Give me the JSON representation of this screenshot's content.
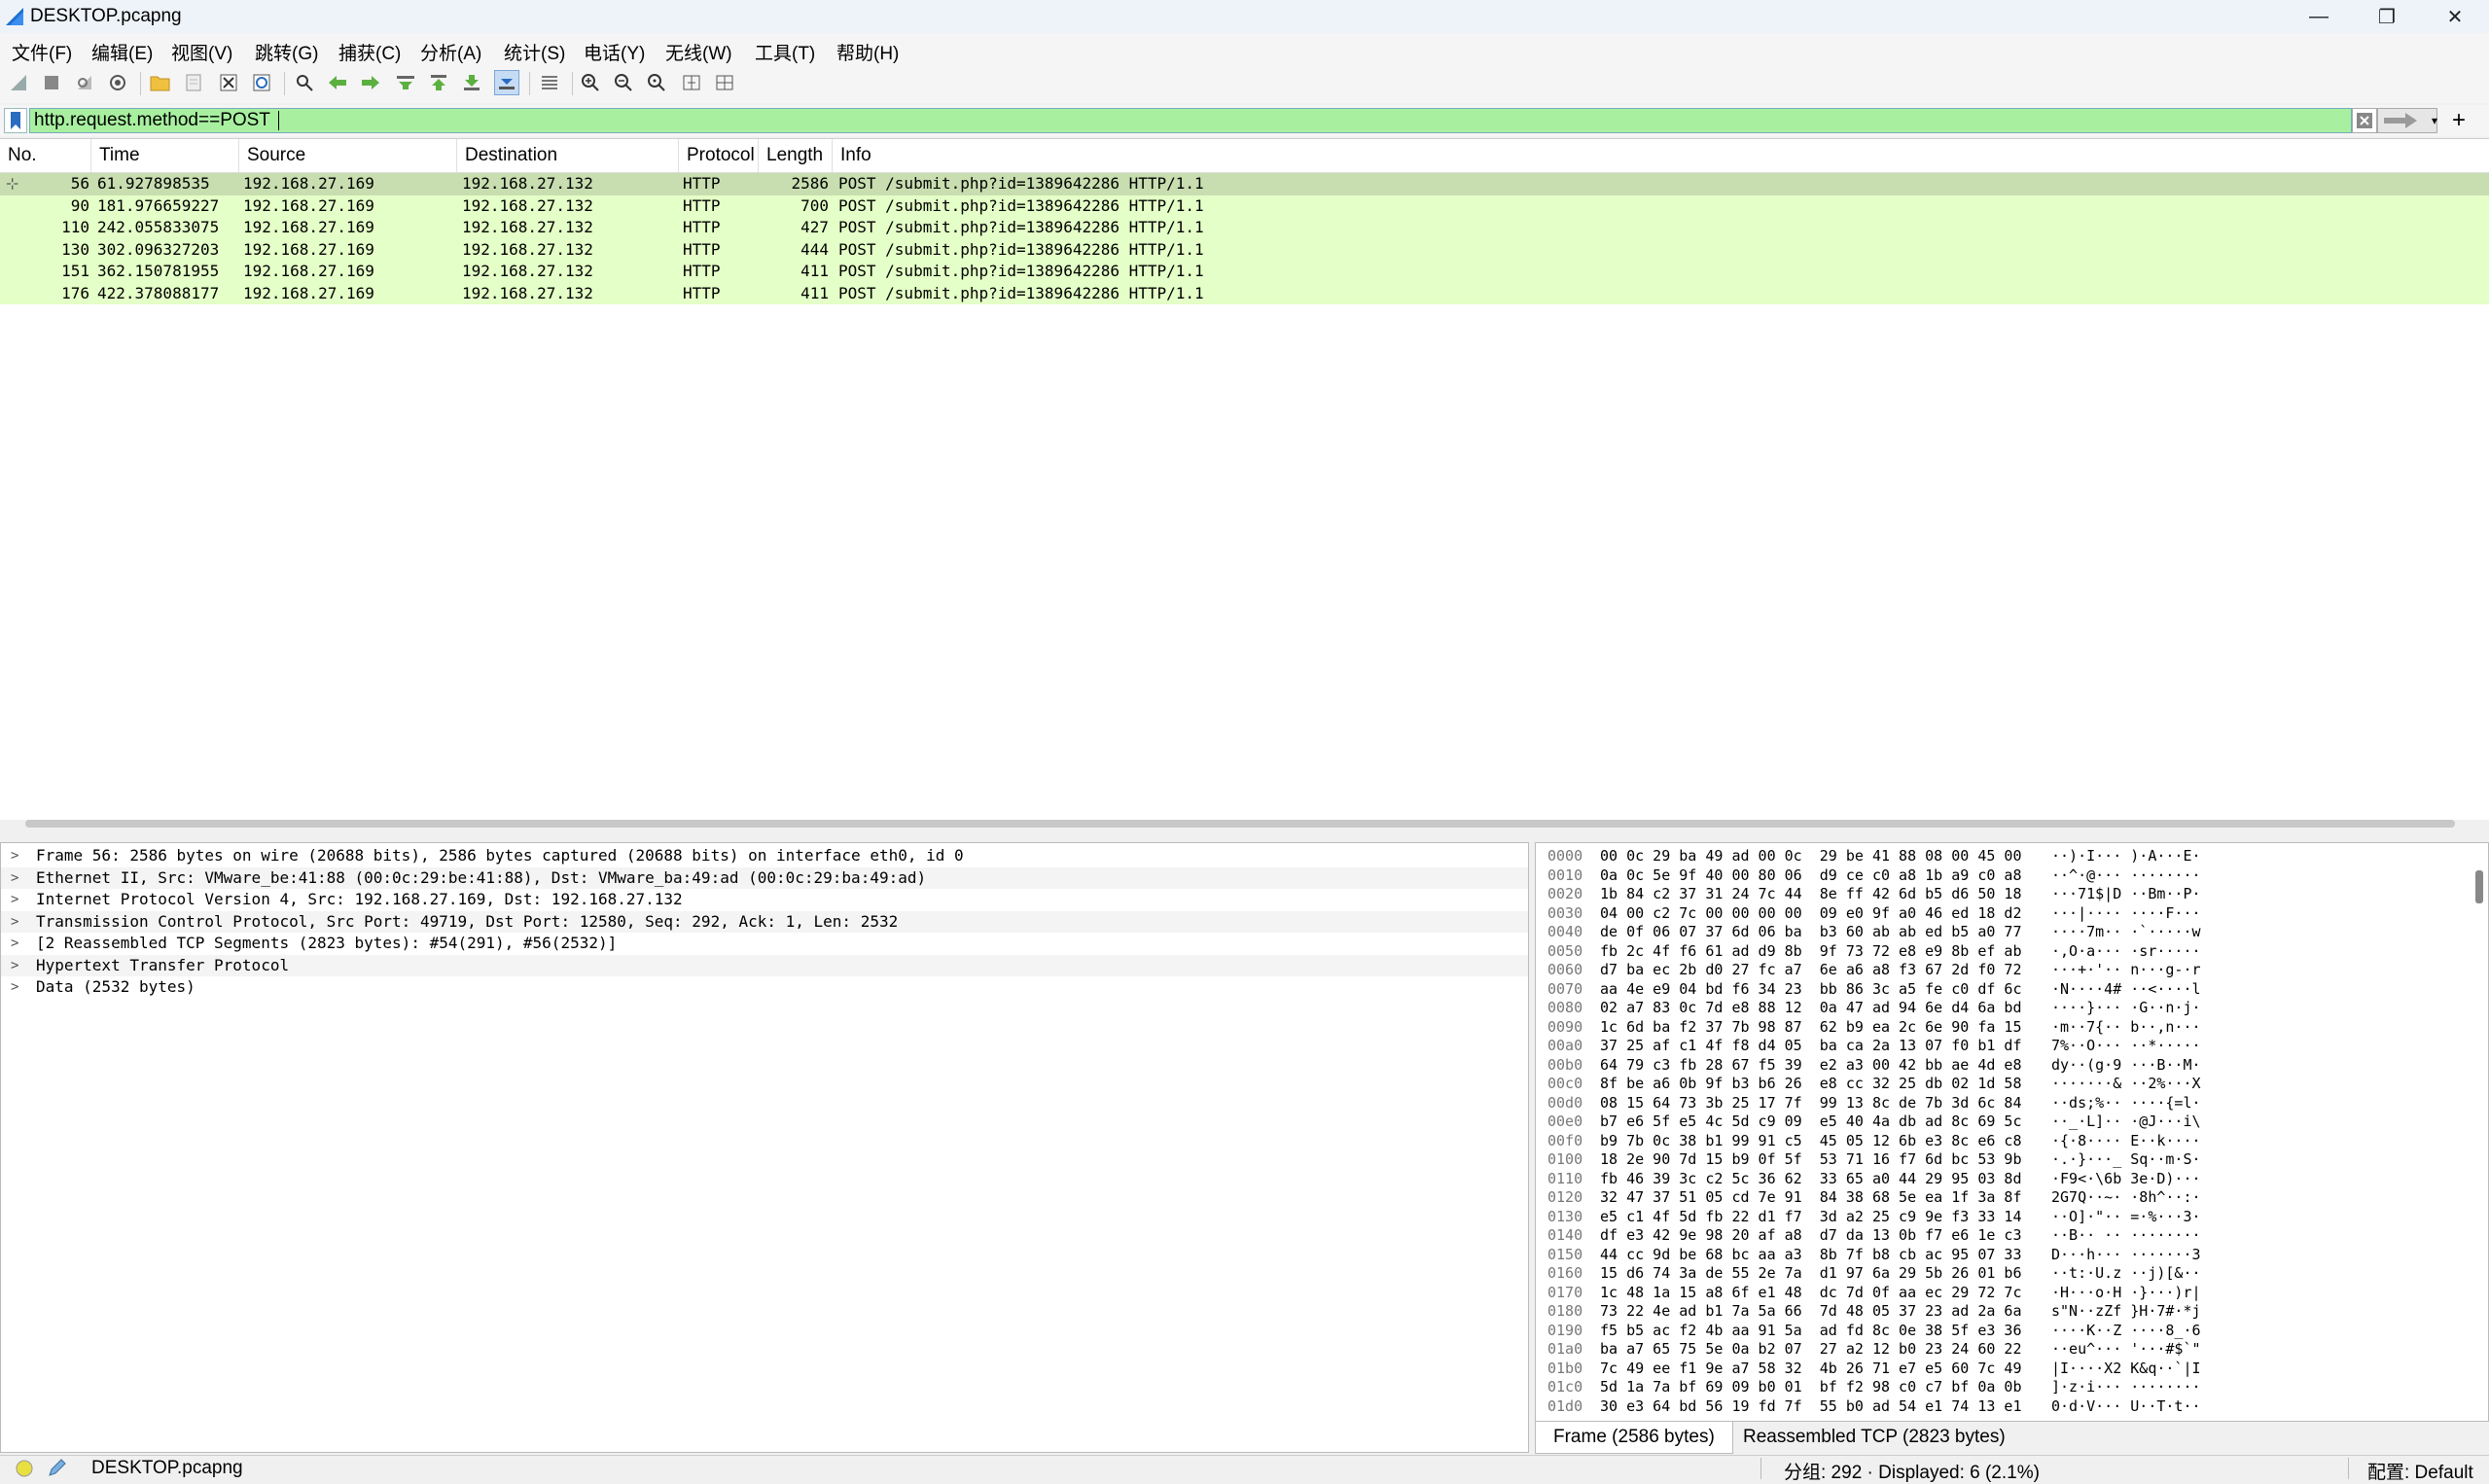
{
  "window": {
    "title": "DESKTOP.pcapng",
    "minimize_glyph": "—",
    "restore_glyph": "❐",
    "close_glyph": "✕"
  },
  "menu": [
    "文件(F)",
    "编辑(E)",
    "视图(V)",
    "跳转(G)",
    "捕获(C)",
    "分析(A)",
    "统计(S)",
    "电话(Y)",
    "无线(W)",
    "工具(T)",
    "帮助(H)"
  ],
  "toolbar_icons": [
    "start-capture-icon",
    "stop-capture-icon",
    "restart-capture-icon",
    "capture-options-icon",
    "open-file-icon",
    "save-file-icon",
    "close-file-icon",
    "reload-file-icon",
    "find-packet-icon",
    "go-back-icon",
    "go-forward-icon",
    "go-to-packet-icon",
    "first-packet-icon",
    "last-packet-icon",
    "autoscroll-icon",
    "colorize-icon",
    "zoom-in-icon",
    "zoom-out-icon",
    "normal-size-icon",
    "resize-columns-icon",
    "layout-icon"
  ],
  "filter": {
    "value": "http.request.method==POST",
    "background": "#a8f0a0",
    "plus_glyph": "+",
    "dropdown_glyph": "▾"
  },
  "packet_list": {
    "columns": [
      "No.",
      "Time",
      "Source",
      "Destination",
      "Protocol",
      "Length",
      "Info"
    ],
    "row_color": "#e4ffc7",
    "selected_color": "#c8deb0",
    "rows": [
      {
        "no": "56",
        "time": "61.927898535",
        "src": "192.168.27.169",
        "dst": "192.168.27.132",
        "proto": "HTTP",
        "len": "2586",
        "info": "POST /submit.php?id=1389642286 HTTP/1.1"
      },
      {
        "no": "90",
        "time": "181.976659227",
        "src": "192.168.27.169",
        "dst": "192.168.27.132",
        "proto": "HTTP",
        "len": "700",
        "info": "POST /submit.php?id=1389642286 HTTP/1.1"
      },
      {
        "no": "110",
        "time": "242.055833075",
        "src": "192.168.27.169",
        "dst": "192.168.27.132",
        "proto": "HTTP",
        "len": "427",
        "info": "POST /submit.php?id=1389642286 HTTP/1.1"
      },
      {
        "no": "130",
        "time": "302.096327203",
        "src": "192.168.27.169",
        "dst": "192.168.27.132",
        "proto": "HTTP",
        "len": "444",
        "info": "POST /submit.php?id=1389642286 HTTP/1.1"
      },
      {
        "no": "151",
        "time": "362.150781955",
        "src": "192.168.27.169",
        "dst": "192.168.27.132",
        "proto": "HTTP",
        "len": "411",
        "info": "POST /submit.php?id=1389642286 HTTP/1.1"
      },
      {
        "no": "176",
        "time": "422.378088177",
        "src": "192.168.27.169",
        "dst": "192.168.27.132",
        "proto": "HTTP",
        "len": "411",
        "info": "POST /submit.php?id=1389642286 HTTP/1.1"
      }
    ]
  },
  "details": [
    "Frame 56: 2586 bytes on wire (20688 bits), 2586 bytes captured (20688 bits) on interface eth0, id 0",
    "Ethernet II, Src: VMware_be:41:88 (00:0c:29:be:41:88), Dst: VMware_ba:49:ad (00:0c:29:ba:49:ad)",
    "Internet Protocol Version 4, Src: 192.168.27.169, Dst: 192.168.27.132",
    "Transmission Control Protocol, Src Port: 49719, Dst Port: 12580, Seq: 292, Ack: 1, Len: 2532",
    "[2 Reassembled TCP Segments (2823 bytes): #54(291), #56(2532)]",
    "Hypertext Transfer Protocol",
    "Data (2532 bytes)"
  ],
  "details_chevron": ">",
  "bytes": [
    {
      "off": "0000",
      "hex": "00 0c 29 ba 49 ad 00 0c  29 be 41 88 08 00 45 00",
      "ascii": "··)·I··· )·A···E·"
    },
    {
      "off": "0010",
      "hex": "0a 0c 5e 9f 40 00 80 06  d9 ce c0 a8 1b a9 c0 a8",
      "ascii": "··^·@··· ········"
    },
    {
      "off": "0020",
      "hex": "1b 84 c2 37 31 24 7c 44  8e ff 42 6d b5 d6 50 18",
      "ascii": "···71$|D ··Bm··P·"
    },
    {
      "off": "0030",
      "hex": "04 00 c2 7c 00 00 00 00  09 e0 9f a0 46 ed 18 d2",
      "ascii": "···|···· ····F···"
    },
    {
      "off": "0040",
      "hex": "de 0f 06 07 37 6d 06 ba  b3 60 ab ab ed b5 a0 77",
      "ascii": "····7m·· ·`·····w"
    },
    {
      "off": "0050",
      "hex": "fb 2c 4f f6 61 ad d9 8b  9f 73 72 e8 e9 8b ef ab",
      "ascii": "·,O·a··· ·sr·····"
    },
    {
      "off": "0060",
      "hex": "d7 ba ec 2b d0 27 fc a7  6e a6 a8 f3 67 2d f0 72",
      "ascii": "···+·'·· n···g-·r"
    },
    {
      "off": "0070",
      "hex": "aa 4e e9 04 bd f6 34 23  bb 86 3c a5 fe c0 df 6c",
      "ascii": "·N····4# ··<····l"
    },
    {
      "off": "0080",
      "hex": "02 a7 83 0c 7d e8 88 12  0a 47 ad 94 6e d4 6a bd",
      "ascii": "····}··· ·G··n·j·"
    },
    {
      "off": "0090",
      "hex": "1c 6d ba f2 37 7b 98 87  62 b9 ea 2c 6e 90 fa 15",
      "ascii": "·m··7{·· b··,n···"
    },
    {
      "off": "00a0",
      "hex": "37 25 af c1 4f f8 d4 05  ba ca 2a 13 07 f0 b1 df",
      "ascii": "7%··O··· ··*·····"
    },
    {
      "off": "00b0",
      "hex": "64 79 c3 fb 28 67 f5 39  e2 a3 00 42 bb ae 4d e8",
      "ascii": "dy··(g·9 ···B··M·"
    },
    {
      "off": "00c0",
      "hex": "8f be a6 0b 9f b3 b6 26  e8 cc 32 25 db 02 1d 58",
      "ascii": "·······& ··2%···X"
    },
    {
      "off": "00d0",
      "hex": "08 15 64 73 3b 25 17 7f  99 13 8c de 7b 3d 6c 84",
      "ascii": "··ds;%·· ····{=l·"
    },
    {
      "off": "00e0",
      "hex": "b7 e6 5f e5 4c 5d c9 09  e5 40 4a db ad 8c 69 5c",
      "ascii": "··_·L]·· ·@J···i\\"
    },
    {
      "off": "00f0",
      "hex": "b9 7b 0c 38 b1 99 91 c5  45 05 12 6b e3 8c e6 c8",
      "ascii": "·{·8···· E··k····"
    },
    {
      "off": "0100",
      "hex": "18 2e 90 7d 15 b9 0f 5f  53 71 16 f7 6d bc 53 9b",
      "ascii": "·.·}···_ Sq··m·S·"
    },
    {
      "off": "0110",
      "hex": "fb 46 39 3c c2 5c 36 62  33 65 a0 44 29 95 03 8d",
      "ascii": "·F9<·\\6b 3e·D)···"
    },
    {
      "off": "0120",
      "hex": "32 47 37 51 05 cd 7e 91  84 38 68 5e ea 1f 3a 8f",
      "ascii": "2G7Q··~· ·8h^··:·"
    },
    {
      "off": "0130",
      "hex": "e5 c1 4f 5d fb 22 d1 f7  3d a2 25 c9 9e f3 33 14",
      "ascii": "··O]·\"·· =·%···3·"
    },
    {
      "off": "0140",
      "hex": "df e3 42 9e 98 20 af a8  d7 da 13 0b f7 e6 1e c3",
      "ascii": "··B·· ·· ········"
    },
    {
      "off": "0150",
      "hex": "44 cc 9d be 68 bc aa a3  8b 7f b8 cb ac 95 07 33",
      "ascii": "D···h··· ·······3"
    },
    {
      "off": "0160",
      "hex": "15 d6 74 3a de 55 2e 7a  d1 97 6a 29 5b 26 01 b6",
      "ascii": "··t:·U.z ··j)[&··"
    },
    {
      "off": "0170",
      "hex": "1c 48 1a 15 a8 6f e1 48  dc 7d 0f aa ec 29 72 7c",
      "ascii": "·H···o·H ·}···)r|"
    },
    {
      "off": "0180",
      "hex": "73 22 4e ad b1 7a 5a 66  7d 48 05 37 23 ad 2a 6a",
      "ascii": "s\"N··zZf }H·7#·*j"
    },
    {
      "off": "0190",
      "hex": "f5 b5 ac f2 4b aa 91 5a  ad fd 8c 0e 38 5f e3 36",
      "ascii": "····K··Z ····8_·6"
    },
    {
      "off": "01a0",
      "hex": "ba a7 65 75 5e 0a b2 07  27 a2 12 b0 23 24 60 22",
      "ascii": "··eu^··· '···#$`\""
    },
    {
      "off": "01b0",
      "hex": "7c 49 ee f1 9e a7 58 32  4b 26 71 e7 e5 60 7c 49",
      "ascii": "|I····X2 K&q··`|I"
    },
    {
      "off": "01c0",
      "hex": "5d 1a 7a bf 69 09 b0 01  bf f2 98 c0 c7 bf 0a 0b",
      "ascii": "]·z·i··· ········"
    },
    {
      "off": "01d0",
      "hex": "30 e3 64 bd 56 19 fd 7f  55 b0 ad 54 e1 74 13 e1",
      "ascii": "0·d·V··· U··T·t··"
    }
  ],
  "bytes_tabs": [
    "Frame (2586 bytes)",
    "Reassembled TCP (2823 bytes)"
  ],
  "status": {
    "file": "DESKTOP.pcapng",
    "packets": "分组: 292 · Displayed: 6 (2.1%)",
    "profile": "配置: Default"
  }
}
